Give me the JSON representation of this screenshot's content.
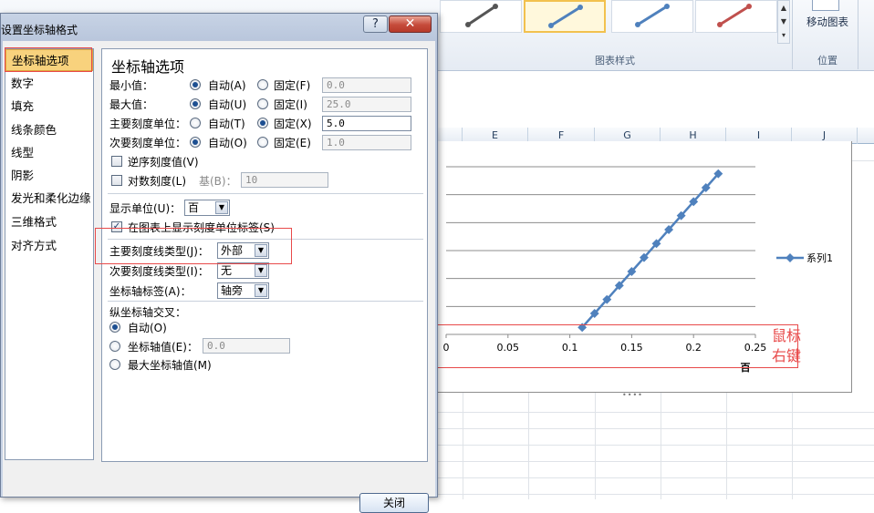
{
  "ribbon": {
    "chart_styles_group": "图表样式",
    "move_chart": "移动图表",
    "position_group": "位置",
    "gallery_scroll": [
      "▲",
      "▼",
      "▾"
    ],
    "style_colors": [
      "#555555",
      "#4f81bd",
      "#4f81bd",
      "#c0504d"
    ]
  },
  "sheet": {
    "columns": [
      "E",
      "F",
      "G",
      "H",
      "I",
      "J"
    ]
  },
  "chart_data": {
    "type": "line",
    "series": [
      {
        "name": "系列1",
        "color": "#4f81bd",
        "x": [
          0.11,
          0.12,
          0.13,
          0.14,
          0.15,
          0.16,
          0.17,
          0.18,
          0.19,
          0.2,
          0.21,
          0.22
        ],
        "y": [
          0.5,
          1.5,
          2.5,
          3.5,
          4.5,
          5.5,
          6.5,
          7.5,
          8.5,
          9.5,
          10.5,
          11.5
        ]
      }
    ],
    "x_ticks": [
      "0",
      "0.05",
      "0.1",
      "0.15",
      "0.2",
      "0.25"
    ],
    "x_range": [
      0,
      0.25
    ],
    "y_range": [
      0,
      12
    ],
    "unit_label": "百",
    "legend_position": "right",
    "gridlines": true
  },
  "annotation": {
    "text": "鼠标右键"
  },
  "dialog": {
    "title": "设置坐标轴格式",
    "help": "?",
    "close_x": "✕",
    "nav": [
      "坐标轴选项",
      "数字",
      "填充",
      "线条颜色",
      "线型",
      "阴影",
      "发光和柔化边缘",
      "三维格式",
      "对齐方式"
    ],
    "panel_title": "坐标轴选项",
    "min_label": "最小值：",
    "max_label": "最大值：",
    "major_unit_label": "主要刻度单位：",
    "minor_unit_label": "次要刻度单位：",
    "auto_a": "自动(A)",
    "fixed_f": "固定(F)",
    "auto_u": "自动(U)",
    "fixed_i": "固定(I)",
    "auto_t": "自动(T)",
    "fixed_x": "固定(X)",
    "auto_o": "自动(O)",
    "fixed_e": "固定(E)",
    "min_value": "0.0",
    "max_value": "25.0",
    "major_value": "5.0",
    "minor_value": "1.0",
    "reverse_label": "逆序刻度值(V)",
    "log_label": "对数刻度(L)",
    "base_label": "基(B)：",
    "base_value": "10",
    "display_unit_label": "显示单位(U)：",
    "display_unit_value": "百",
    "show_unit_label": "在图表上显示刻度单位标签(S)",
    "major_tick_label": "主要刻度线类型(J)：",
    "major_tick_value": "外部",
    "minor_tick_label": "次要刻度线类型(I)：",
    "minor_tick_value": "无",
    "axis_labels_label": "坐标轴标签(A)：",
    "axis_labels_value": "轴旁",
    "cross_label": "纵坐标轴交叉：",
    "cross_auto": "自动(O)",
    "cross_value_label": "坐标轴值(E)：",
    "cross_value": "0.0",
    "cross_max": "最大坐标轴值(M)",
    "close_button": "关闭"
  }
}
